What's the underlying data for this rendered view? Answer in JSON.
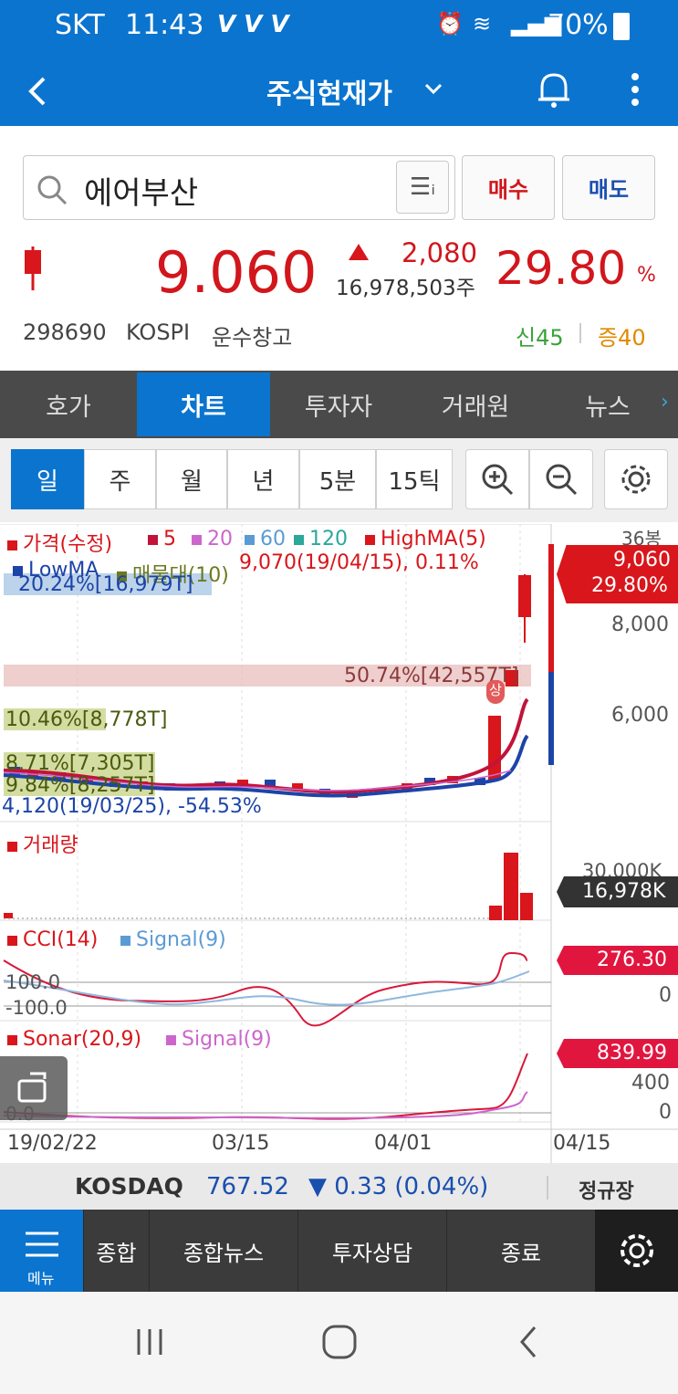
{
  "status": {
    "carrier": "SKT",
    "time": "11:43",
    "battery": "70%"
  },
  "header": {
    "title": "주식현재가"
  },
  "search": {
    "value": "에어부산",
    "buy": "매수",
    "sell": "매도"
  },
  "quote": {
    "price": "9.060",
    "change": "2,080",
    "volume": "16,978,503주",
    "pct": "29.80",
    "pct_unit": "%",
    "code": "298690",
    "market": "KOSPI",
    "sector": "운수창고",
    "shin": "신45",
    "jeung": "증40"
  },
  "tabs": [
    "호가",
    "차트",
    "투자자",
    "거래원",
    "뉴스"
  ],
  "periods": [
    "일",
    "주",
    "월",
    "년",
    "5분",
    "15틱"
  ],
  "chart_data": {
    "type": "candlestick",
    "legend": {
      "price": "가격(수정)",
      "ma": [
        "5",
        "20",
        "60",
        "120"
      ],
      "highma": "HighMA(5)",
      "lowma": "LowMA",
      "mat": "매물대(10)"
    },
    "count": "36봉",
    "high_annot": "9,070(19/04/15), 0.11%",
    "low_annot": "4,120(19/03/25), -54.53%",
    "bands": [
      "20.24%[16,979T]",
      "50.74%[42,557T]",
      "10.46%[8,778T]",
      "8.71%[7,305T]",
      "9.84%[8,257T]"
    ],
    "price_ticks": [
      "8,000",
      "6,000"
    ],
    "last_price": "9,060",
    "last_pct": "29.80%",
    "volume": {
      "title": "거래량",
      "tick": "30,000K",
      "last": "16,978K"
    },
    "cci": {
      "title": "CCI(14)",
      "signal": "Signal(9)",
      "levels": [
        "100.0",
        "-100.0"
      ],
      "last": "276.30",
      "tick": "0"
    },
    "sonar": {
      "title": "Sonar(20,9)",
      "signal": "Signal(9)",
      "level": "0.0",
      "last": "839.99",
      "ticks": [
        "400",
        "0"
      ]
    },
    "x_ticks": [
      "19/02/22",
      "03/15",
      "04/01",
      "04/15"
    ],
    "annot_marker": "상",
    "colors": {
      "up": "#d8161b",
      "down": "#1c44a8",
      "ma5": "#c2133a",
      "ma20": "#cc66cc"
    }
  },
  "ticker": {
    "index": "KOSDAQ",
    "value": "767.52",
    "change": "▼ 0.33 (0.04%)",
    "session": "정규장"
  },
  "nav": {
    "menu": "메뉴",
    "items": [
      "종합",
      "종합뉴스",
      "투자상담",
      "종료"
    ]
  }
}
